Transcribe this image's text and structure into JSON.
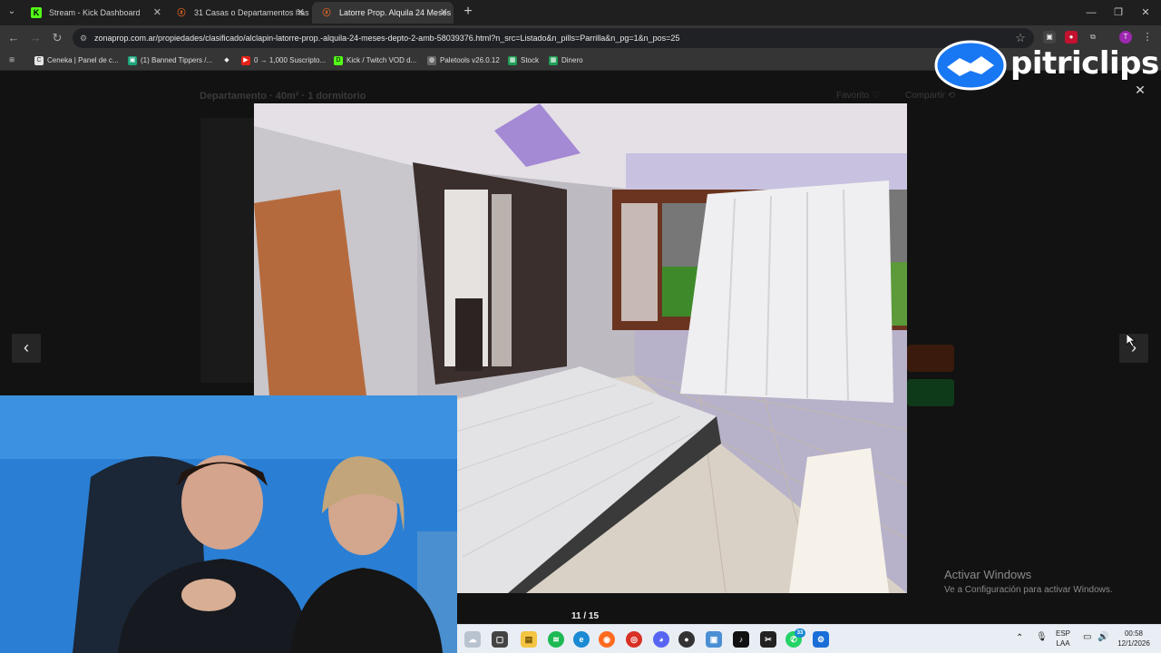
{
  "browser": {
    "tabs": [
      {
        "label": "Stream - Kick Dashboard",
        "favicon": "K",
        "active": false
      },
      {
        "label": "31 Casas o Departamentos has",
        "favicon": "z",
        "active": false
      },
      {
        "label": "Latorre Prop. Alquila 24 Meses",
        "favicon": "z",
        "active": true
      }
    ],
    "new_tab": "+",
    "window_controls": {
      "minimize": "—",
      "restore": "❐",
      "close": "✕"
    },
    "url": "zonaprop.com.ar/propiedades/clasificado/alclapin-latorre-prop.-alquila-24-meses-depto-2-amb-58039376.html?n_src=Listado&n_pills=Parrilla&n_pg=1&n_pos=25",
    "profile_initial": "T"
  },
  "bookmarks": [
    {
      "label": "Ceneka | Panel de c...",
      "icon": "C",
      "color": "#e5e5e5"
    },
    {
      "label": "(1) Banned Tippers /...",
      "icon": "▣",
      "color": "#1aa37a"
    },
    {
      "label": "",
      "icon": "◆",
      "color": "#444"
    },
    {
      "label": "0 → 1,000 Suscripto...",
      "icon": "▶",
      "color": "#e62117"
    },
    {
      "label": "Kick / Twitch VOD d...",
      "icon": "D",
      "color": "#1e1e1e"
    },
    {
      "label": "Paletools v26.0.12",
      "icon": "◍",
      "color": "#555"
    },
    {
      "label": "Stock",
      "icon": "▦",
      "color": "#1f9d55"
    },
    {
      "label": "Dinero",
      "icon": "▦",
      "color": "#1f9d55"
    }
  ],
  "page": {
    "title": "Departamento · 40m² · 1 dormitorio",
    "favorite_label": "Favorito ♡",
    "share_label": "Compartir ⟲"
  },
  "gallery": {
    "counter": "11 / 15",
    "prev": "‹",
    "next": "›",
    "close": "✕",
    "current": 11,
    "total": 15
  },
  "watermark": {
    "brand": "pitriclips",
    "activate_title": "Activar Windows",
    "activate_sub": "Ve a Configuración para activar Windows."
  },
  "taskbar": {
    "language_top": "ESP",
    "language_bottom": "LAA",
    "time": "00:58",
    "date": "12/1/2026",
    "whatsapp_badge": "33"
  }
}
